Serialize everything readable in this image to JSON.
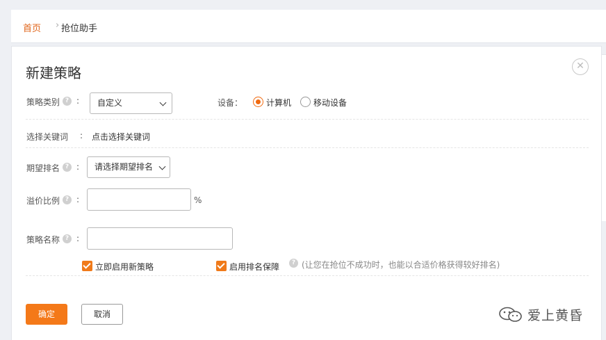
{
  "breadcrumb": {
    "home": "首页",
    "separator": "›",
    "current": "抢位助手"
  },
  "dialog": {
    "title": "新建策略",
    "close_icon": "close-circle-icon",
    "strategy_type": {
      "label": "策略类别",
      "value": "自定义"
    },
    "device": {
      "label": "设备：",
      "options": [
        {
          "label": "计算机",
          "selected": true
        },
        {
          "label": "移动设备",
          "selected": false
        }
      ]
    },
    "keywords": {
      "label": "选择关键词",
      "link": "点击选择关键词"
    },
    "expected_rank": {
      "label": "期望排名",
      "placeholder": "请选择期望排名"
    },
    "premium_ratio": {
      "label": "溢价比例",
      "value": "",
      "unit": "%"
    },
    "strategy_name": {
      "label": "策略名称",
      "value": ""
    },
    "enable_now": {
      "label": "立即启用新策略",
      "checked": true
    },
    "rank_guarantee": {
      "label": "启用排名保障",
      "checked": true,
      "hint": "(让您在抢位不成功时，也能以合适价格获得较好排名)"
    },
    "ok_label": "确定",
    "cancel_label": "取消"
  },
  "watermark": {
    "text": "爱上黄昏",
    "icon": "wechat-icon"
  },
  "colors": {
    "accent": "#f47919",
    "link": "#e0651b"
  }
}
